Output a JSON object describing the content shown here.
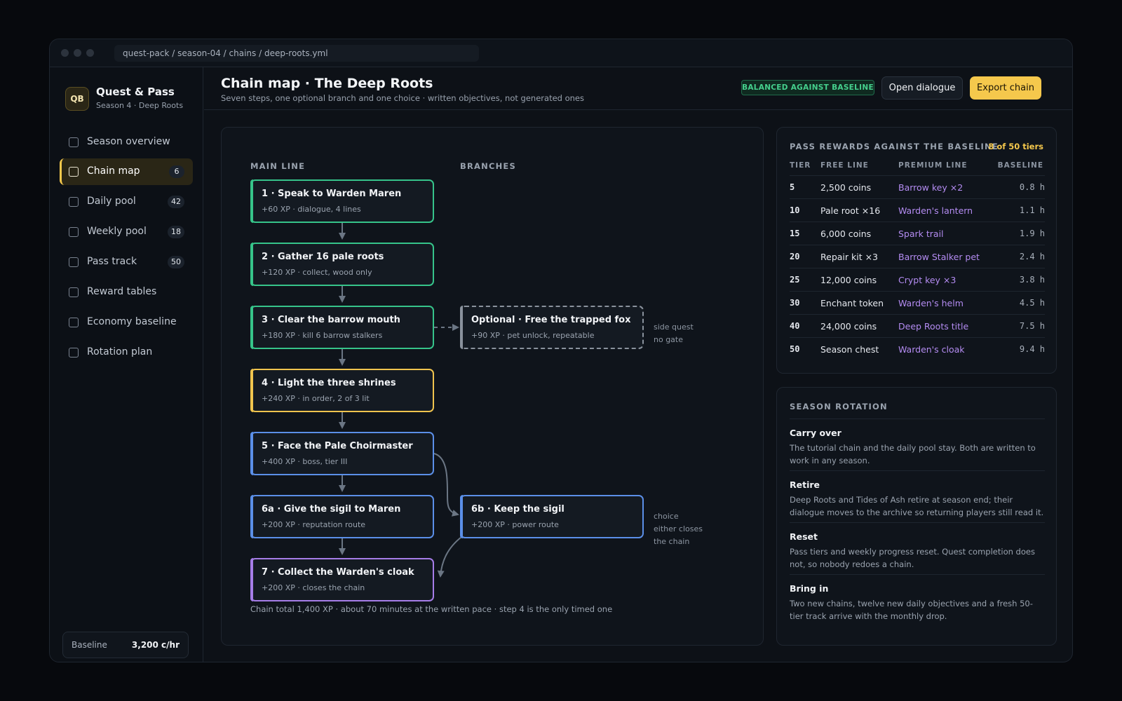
{
  "window": {
    "path": "quest-pack / season-04 / chains / deep-roots.yml"
  },
  "brand": {
    "logo": "QB",
    "name": "Quest & Pass",
    "subtitle": "Season 4 · Deep Roots"
  },
  "nav": [
    {
      "label": "Season overview",
      "count": ""
    },
    {
      "label": "Chain map",
      "count": "6",
      "active": true
    },
    {
      "label": "Daily pool",
      "count": "42"
    },
    {
      "label": "Weekly pool",
      "count": "18"
    },
    {
      "label": "Pass track",
      "count": "50"
    },
    {
      "label": "Reward tables",
      "count": ""
    },
    {
      "label": "Economy baseline",
      "count": ""
    },
    {
      "label": "Rotation plan",
      "count": ""
    }
  ],
  "baseline": {
    "label": "Baseline",
    "value": "3,200 c/hr"
  },
  "header": {
    "title": "Chain map · The Deep Roots",
    "subtitle": "Seven steps, one optional branch and one choice · written objectives, not generated ones",
    "badge": "BALANCED AGAINST BASELINE",
    "open_dialogue": "Open dialogue",
    "export_chain": "Export chain"
  },
  "chain": {
    "main_label": "MAIN LINE",
    "branch_label": "BRANCHES",
    "nodes": [
      {
        "title": "1 · Speak to Warden Maren",
        "detail": "+60 XP · dialogue, 4 lines"
      },
      {
        "title": "2 · Gather 16 pale roots",
        "detail": "+120 XP · collect, wood only"
      },
      {
        "title": "3 · Clear the barrow mouth",
        "detail": "+180 XP · kill 6 barrow stalkers"
      },
      {
        "title": "4 · Light the three shrines",
        "detail": "+240 XP · in order, 2 of 3 lit"
      },
      {
        "title": "5 · Face the Pale Choirmaster",
        "detail": "+400 XP · boss, tier III"
      },
      {
        "title": "6a · Give the sigil to Maren",
        "detail": "+200 XP · reputation route"
      },
      {
        "title": "7 · Collect the Warden's cloak",
        "detail": "+200 XP · closes the chain"
      }
    ],
    "optional": {
      "title": "Optional · Free the trapped fox",
      "detail": "+90 XP · pet unlock, repeatable",
      "note_1": "side quest",
      "note_2": "no gate"
    },
    "choice": {
      "title": "6b · Keep the sigil",
      "detail": "+200 XP · power route",
      "note_1": "choice",
      "note_2": "either closes",
      "note_3": "the chain"
    },
    "total": "Chain total 1,400 XP · about 70 minutes at the written pace · step 4 is the only timed one"
  },
  "rewards": {
    "title": "PASS REWARDS AGAINST THE BASELINE",
    "count": "8 of 50 tiers",
    "headers": {
      "tier": "TIER",
      "free": "FREE LINE",
      "premium": "PREMIUM LINE",
      "baseline": "BASELINE"
    },
    "rows": [
      {
        "tier": "5",
        "free": "2,500 coins",
        "premium": "Barrow key ×2",
        "baseline": "0.8 h"
      },
      {
        "tier": "10",
        "free": "Pale root ×16",
        "premium": "Warden's lantern",
        "baseline": "1.1 h"
      },
      {
        "tier": "15",
        "free": "6,000 coins",
        "premium": "Spark trail",
        "baseline": "1.9 h"
      },
      {
        "tier": "20",
        "free": "Repair kit ×3",
        "premium": "Barrow Stalker pet",
        "baseline": "2.4 h"
      },
      {
        "tier": "25",
        "free": "12,000 coins",
        "premium": "Crypt key ×3",
        "baseline": "3.8 h"
      },
      {
        "tier": "30",
        "free": "Enchant token",
        "premium": "Warden's helm",
        "baseline": "4.5 h"
      },
      {
        "tier": "40",
        "free": "24,000 coins",
        "premium": "Deep Roots title",
        "baseline": "7.5 h"
      },
      {
        "tier": "50",
        "free": "Season chest",
        "premium": "Warden's cloak",
        "baseline": "9.4 h"
      }
    ]
  },
  "rotation": {
    "title": "SEASON ROTATION",
    "items": [
      {
        "title": "Carry over",
        "body": "The tutorial chain and the daily pool stay. Both are written to work in any season."
      },
      {
        "title": "Retire",
        "body": "Deep Roots and Tides of Ash retire at season end; their dialogue moves to the archive so returning players still read it."
      },
      {
        "title": "Reset",
        "body": "Pass tiers and weekly progress reset. Quest completion does not, so nobody redoes a chain."
      },
      {
        "title": "Bring in",
        "body": "Two new chains, twelve new daily objectives and a fresh 50-tier track arrive with the monthly drop."
      }
    ]
  },
  "colors": {
    "accent": "#f5c84c",
    "green": "#36c48a",
    "yellow": "#f0c44e",
    "blue": "#5b8fe8",
    "purple": "#a67de8",
    "premium": "#b48cf2"
  }
}
